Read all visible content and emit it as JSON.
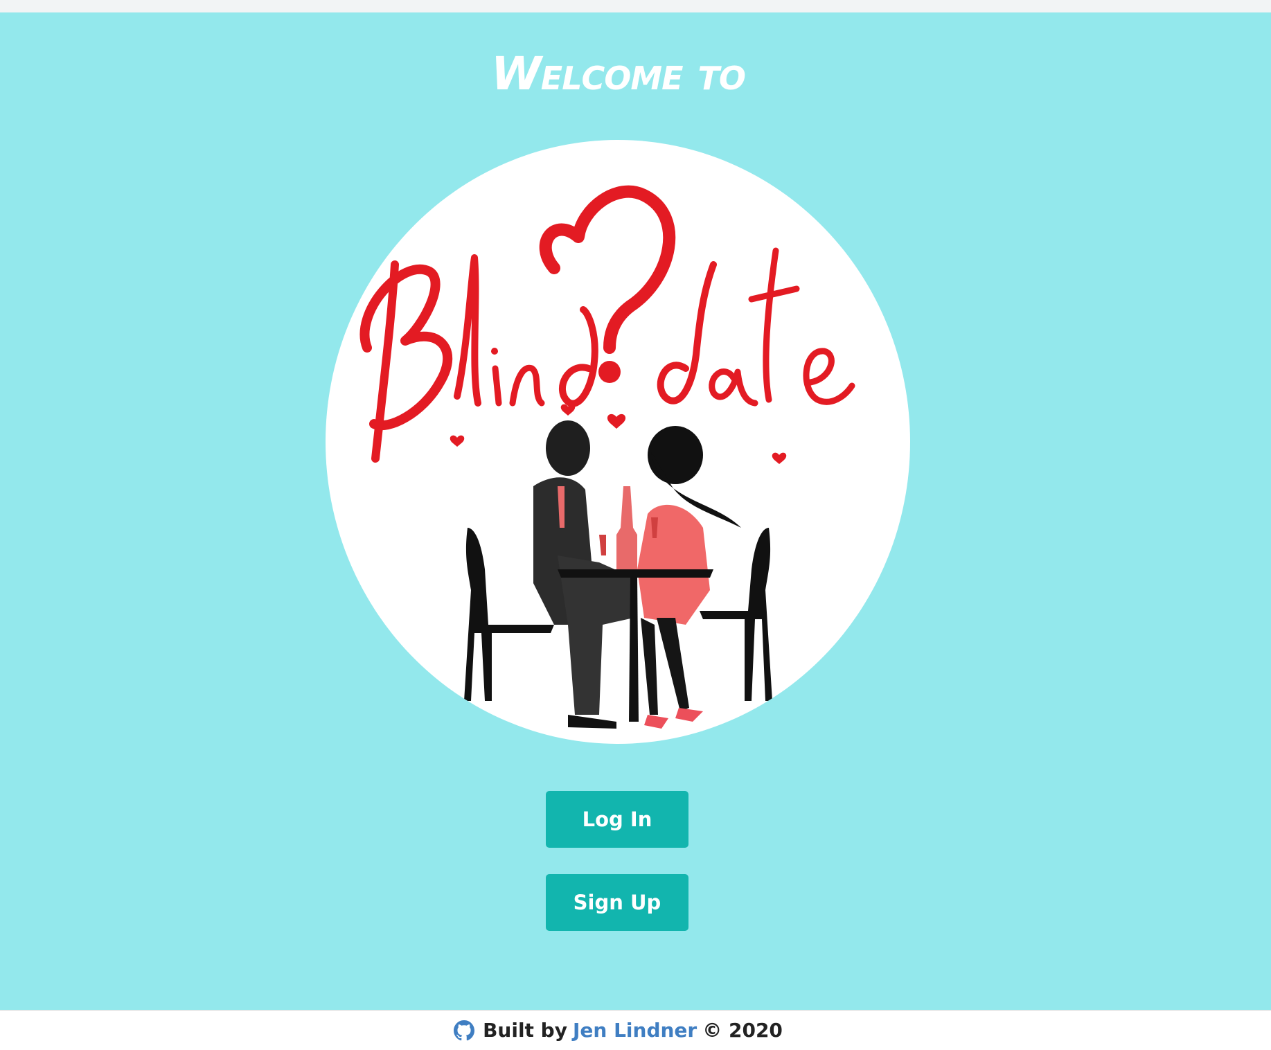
{
  "page": {
    "welcome": "Welcome to",
    "logo": {
      "wordmark": "Blind date",
      "icon": "couple-at-table-illustration"
    }
  },
  "actions": {
    "login_label": "Log In",
    "signup_label": "Sign Up"
  },
  "footer": {
    "built_by": "Built by",
    "author": "Jen Lindner",
    "copyright": "© 2020",
    "icon": "github-icon"
  },
  "colors": {
    "hero_background": "#93e8ec",
    "button": "#12b5ae",
    "logo_red": "#e31b23",
    "link": "#3f7ec2"
  }
}
